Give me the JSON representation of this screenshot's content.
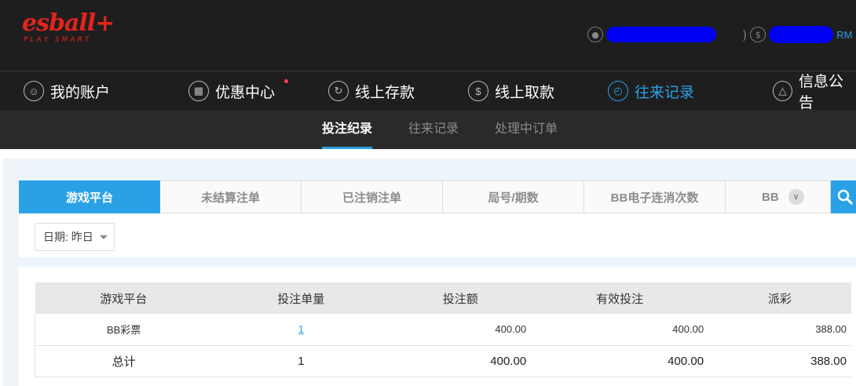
{
  "logo": {
    "main": "esball+",
    "sub": "PLAY SMART"
  },
  "account": {
    "currency": "RM"
  },
  "nav": [
    {
      "label": "我的账户",
      "icon": "user-icon"
    },
    {
      "label": "优惠中心",
      "icon": "gift-icon"
    },
    {
      "label": "线上存款",
      "icon": "deposit-icon"
    },
    {
      "label": "线上取款",
      "icon": "withdraw-icon"
    },
    {
      "label": "往来记录",
      "icon": "record-icon"
    },
    {
      "label": "信息公告",
      "icon": "bell-icon"
    }
  ],
  "subnav": [
    {
      "label": "投注纪录"
    },
    {
      "label": "往来记录"
    },
    {
      "label": "处理中订单"
    }
  ],
  "filter_tabs": [
    {
      "label": "游戏平台"
    },
    {
      "label": "未结算注单"
    },
    {
      "label": "已注销注单"
    },
    {
      "label": "局号/期数"
    },
    {
      "label": "BB电子连消次数"
    },
    {
      "label": "BB"
    }
  ],
  "date_filter": {
    "label": "日期: 昨日"
  },
  "table": {
    "headers": [
      "游戏平台",
      "投注单量",
      "投注额",
      "有效投注",
      "派彩"
    ],
    "rows": [
      {
        "platform": "BB彩票",
        "count": "1",
        "bet": "400.00",
        "valid": "400.00",
        "payout": "388.00"
      }
    ],
    "total": {
      "label": "总计",
      "count": "1",
      "bet": "400.00",
      "valid": "400.00",
      "payout": "388.00"
    }
  },
  "colors": {
    "accent": "#2aa1e6",
    "brand": "#e3241b",
    "dark": "#1e1e1e"
  }
}
